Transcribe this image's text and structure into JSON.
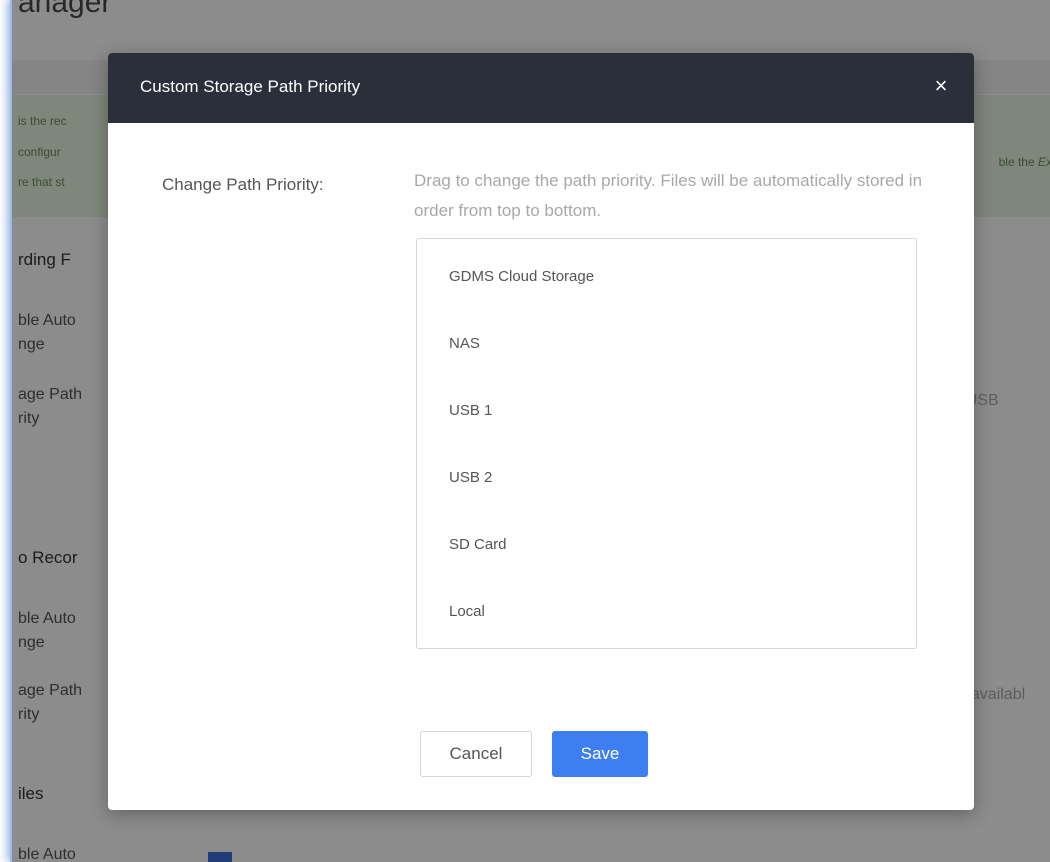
{
  "background": {
    "page_title": "anager",
    "notice_lines": [
      "is the rec",
      "configur",
      "re that st"
    ],
    "notice_right_prefix": "ble the ",
    "notice_right_em": "Ex",
    "sections": [
      {
        "heading": "rding F",
        "labels": [
          "ble Auto",
          "nge",
          "age Path",
          "rity"
        ]
      },
      {
        "heading": "o Recor",
        "labels": [
          "ble Auto",
          "nge",
          "age Path",
          "rity"
        ]
      },
      {
        "heading": "iles",
        "labels": [
          "ble Auto"
        ]
      }
    ],
    "right_values": [
      "> USB",
      "navailabl"
    ]
  },
  "modal": {
    "title": "Custom Storage Path Priority",
    "close_glyph": "×",
    "field_label": "Change Path Priority:",
    "hint": "Drag to change the path priority. Files will be automatically stored in order from top to bottom.",
    "paths": [
      "GDMS Cloud Storage",
      "NAS",
      "USB 1",
      "USB 2",
      "SD Card",
      "Local"
    ],
    "cancel_label": "Cancel",
    "save_label": "Save"
  },
  "colors": {
    "header_bg": "#2b2f3a",
    "primary": "#3d7ff0",
    "notice_bg": "#e7f4e2"
  }
}
